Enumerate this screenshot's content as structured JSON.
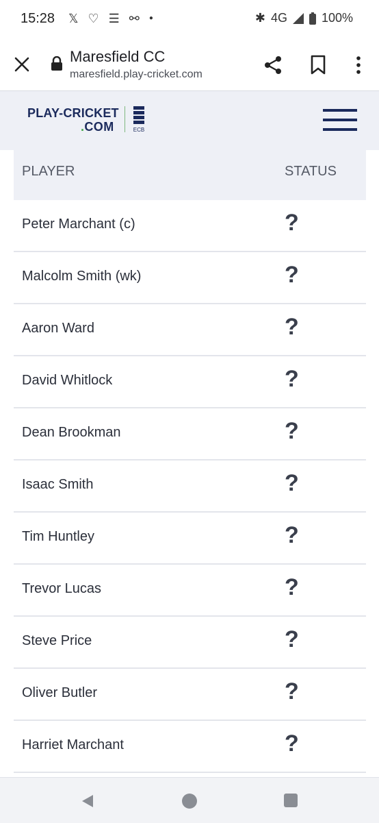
{
  "status_bar": {
    "time": "15:28",
    "left_icons": [
      "x-app-icon",
      "heart-rate-icon",
      "news-icon",
      "link-icon",
      "dot-icon"
    ],
    "network": "4G",
    "battery": "100%"
  },
  "browser": {
    "title": "Maresfield CC",
    "url": "maresfield.play-cricket.com"
  },
  "site_header": {
    "logo_line1": "PLAY-CRICKET",
    "logo_line2_dot": ".",
    "logo_line2_text": "COM",
    "partner_logo": "ECB",
    "brand_color": "#1b2a5c",
    "accent_color": "#44a84a"
  },
  "table": {
    "headers": {
      "player": "PLAYER",
      "status": "STATUS"
    },
    "rows": [
      {
        "name": "Peter Marchant (c)",
        "status": "?"
      },
      {
        "name": "Malcolm Smith (wk)",
        "status": "?"
      },
      {
        "name": "Aaron Ward",
        "status": "?"
      },
      {
        "name": "David Whitlock",
        "status": "?"
      },
      {
        "name": "Dean Brookman",
        "status": "?"
      },
      {
        "name": "Isaac Smith",
        "status": "?"
      },
      {
        "name": "Tim Huntley",
        "status": "?"
      },
      {
        "name": "Trevor Lucas",
        "status": "?"
      },
      {
        "name": "Steve Price",
        "status": "?"
      },
      {
        "name": "Oliver Butler",
        "status": "?"
      },
      {
        "name": "Harriet Marchant",
        "status": "?"
      }
    ]
  }
}
